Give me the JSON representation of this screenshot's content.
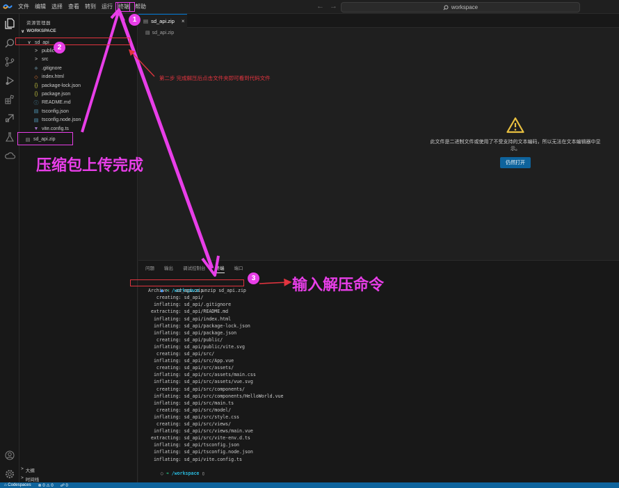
{
  "menu": {
    "items": [
      "文件",
      "编辑",
      "选择",
      "查看",
      "转到",
      "运行",
      "终端",
      "帮助"
    ],
    "highlighted_index": 6
  },
  "command_center": {
    "text": "workspace",
    "icon": "search-icon"
  },
  "activity_bar": {
    "icons": [
      "explorer-icon",
      "search-icon",
      "source-control-icon",
      "run-debug-icon",
      "extensions-icon",
      "remote-icon",
      "testing-icon",
      "cloud-icon"
    ],
    "bottom_icons": [
      "account-icon",
      "settings-gear-icon"
    ]
  },
  "sidebar": {
    "title": "资源管理器",
    "workspace_label": "WORKSPACE",
    "tree": [
      {
        "label": "sd_api",
        "kind": "folder-open",
        "depth": 1,
        "glyph": "∨"
      },
      {
        "label": "public",
        "kind": "folder",
        "depth": 2,
        "glyph": ">"
      },
      {
        "label": "src",
        "kind": "folder",
        "depth": 2,
        "glyph": ">"
      },
      {
        "label": ".gitignore",
        "kind": "git",
        "depth": 2,
        "glyph": "◆"
      },
      {
        "label": "index.html",
        "kind": "html",
        "depth": 2,
        "glyph": "◇"
      },
      {
        "label": "package-lock.json",
        "kind": "json",
        "depth": 2,
        "glyph": "{}"
      },
      {
        "label": "package.json",
        "kind": "json",
        "depth": 2,
        "glyph": "{}"
      },
      {
        "label": "README.md",
        "kind": "md",
        "depth": 2,
        "glyph": "ⓘ"
      },
      {
        "label": "tsconfig.json",
        "kind": "ts",
        "depth": 2,
        "glyph": "▤"
      },
      {
        "label": "tsconfig.node.json",
        "kind": "ts",
        "depth": 2,
        "glyph": "▤"
      },
      {
        "label": "vite.config.ts",
        "kind": "vite",
        "depth": 2,
        "glyph": "▼"
      },
      {
        "label": "sd_api.zip",
        "kind": "zip",
        "depth": 1,
        "glyph": "▤"
      }
    ],
    "bottom_sections": [
      "大纲",
      "时间线"
    ]
  },
  "editor": {
    "tab_label": "sd_api.zip",
    "tab_close": "×",
    "breadcrumb": "sd_api.zip",
    "notice": "此文件是二进制文件或使用了不受支持的文本编码，所以无法在文本编辑器中显示。",
    "open_anyway": "仍然打开"
  },
  "panel": {
    "tabs": [
      "问题",
      "输出",
      "调试控制台",
      "终端",
      "端口"
    ],
    "active_tab_index": 3,
    "prompt_dir": "/workspace",
    "command": "unzip sd_api.zip",
    "output": [
      "Archive:  sd_api.zip",
      "   creating: sd_api/",
      "  inflating: sd_api/.gitignore",
      " extracting: sd_api/README.md",
      "  inflating: sd_api/index.html",
      "  inflating: sd_api/package-lock.json",
      "  inflating: sd_api/package.json",
      "   creating: sd_api/public/",
      "  inflating: sd_api/public/vite.svg",
      "   creating: sd_api/src/",
      "  inflating: sd_api/src/App.vue",
      "   creating: sd_api/src/assets/",
      "  inflating: sd_api/src/assets/main.css",
      "  inflating: sd_api/src/assets/vue.svg",
      "   creating: sd_api/src/components/",
      "  inflating: sd_api/src/components/HelloWorld.vue",
      "  inflating: sd_api/src/main.ts",
      "   creating: sd_api/src/model/",
      "  inflating: sd_api/src/style.css",
      "   creating: sd_api/src/views/",
      "  inflating: sd_api/src/views/main.vue",
      " extracting: sd_api/src/vite-env.d.ts",
      "  inflating: sd_api/tsconfig.json",
      "  inflating: sd_api/tsconfig.node.json",
      "  inflating: sd_api/vite.config.ts"
    ],
    "final_prompt_dir": "/workspace",
    "final_cursor": "▯"
  },
  "status_bar": {
    "items": [
      "⌂ Codespaces",
      "⊗ 0  ⚠ 0",
      "☍ 0"
    ]
  },
  "annotations": {
    "badges": [
      "1",
      "2",
      "3"
    ],
    "upload_done": "压缩包上传完成",
    "input_unzip": "输入解压命令",
    "step2_note": "第二步 完成解压后点击文件夹即可看到代码文件"
  },
  "colors": {
    "annotation_pink": "#e83ee8",
    "annotation_red": "#e2343f",
    "accent_blue": "#0e639c"
  }
}
